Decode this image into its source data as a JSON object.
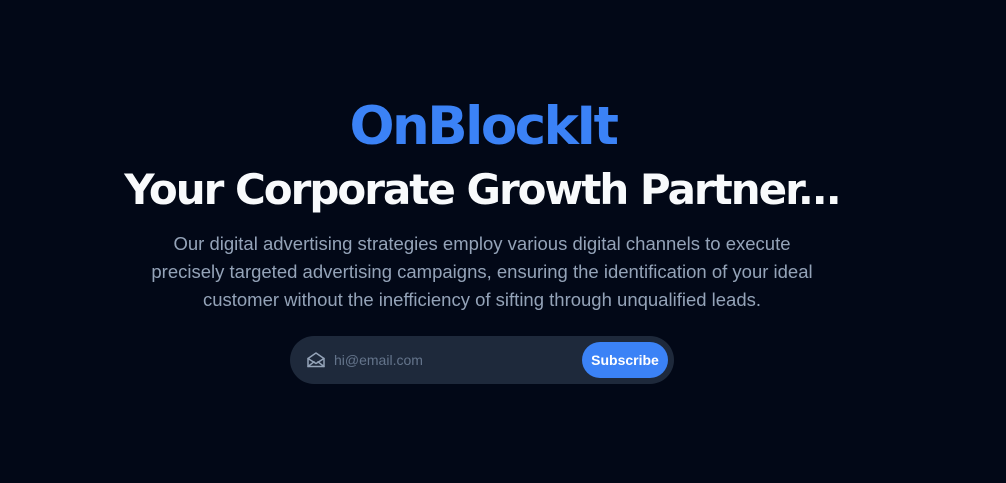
{
  "hero": {
    "brand": "OnBlockIt",
    "headline": "Your Corporate Growth Partner...",
    "description": "Our digital advertising strategies employ various digital channels to execute precisely targeted advertising campaigns, ensuring the identification of your ideal customer without the inefficiency of sifting through unqualified leads."
  },
  "subscribe": {
    "email_value": "",
    "email_placeholder": "hi@email.com",
    "button_label": "Subscribe",
    "icon": "mail-open-icon"
  },
  "colors": {
    "background": "#020817",
    "accent": "#3b82f6",
    "headline": "#f8fafc",
    "body_text": "#94a3b8",
    "input_background": "#1e293b",
    "placeholder": "#64748b"
  }
}
